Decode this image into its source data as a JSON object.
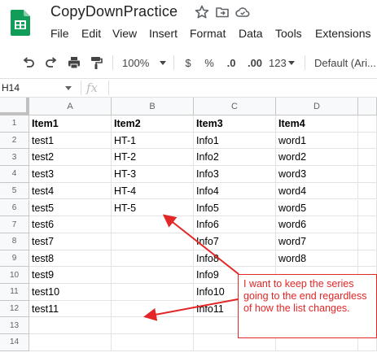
{
  "app": {
    "title": "CopyDownPractice",
    "menu": [
      "File",
      "Edit",
      "View",
      "Insert",
      "Format",
      "Data",
      "Tools",
      "Extensions"
    ]
  },
  "toolbar": {
    "zoom": "100%",
    "currency": "$",
    "percent": "%",
    "dec_decrease": ".0",
    "dec_increase": ".00",
    "more_formats": "123",
    "font": "Default (Ari..."
  },
  "formula_bar": {
    "name_box": "H14",
    "fx": "fx",
    "value": ""
  },
  "sheet": {
    "columns": [
      "A",
      "B",
      "C",
      "D"
    ],
    "rows": [
      {
        "num": "1",
        "cells": [
          "Item1",
          "Item2",
          "Item3",
          "Item4"
        ]
      },
      {
        "num": "2",
        "cells": [
          "test1",
          "HT-1",
          "Info1",
          "word1"
        ]
      },
      {
        "num": "3",
        "cells": [
          "test2",
          "HT-2",
          "Info2",
          "word2"
        ]
      },
      {
        "num": "4",
        "cells": [
          "test3",
          "HT-3",
          "Info3",
          "word3"
        ]
      },
      {
        "num": "5",
        "cells": [
          "test4",
          "HT-4",
          "Info4",
          "word4"
        ]
      },
      {
        "num": "6",
        "cells": [
          "test5",
          "HT-5",
          "Info5",
          "word5"
        ]
      },
      {
        "num": "7",
        "cells": [
          "test6",
          "",
          "Info6",
          "word6"
        ]
      },
      {
        "num": "8",
        "cells": [
          "test7",
          "",
          "Info7",
          "word7"
        ]
      },
      {
        "num": "9",
        "cells": [
          "test8",
          "",
          "Info8",
          "word8"
        ]
      },
      {
        "num": "10",
        "cells": [
          "test9",
          "",
          "Info9",
          ""
        ]
      },
      {
        "num": "11",
        "cells": [
          "test10",
          "",
          "Info10",
          ""
        ]
      },
      {
        "num": "12",
        "cells": [
          "test11",
          "",
          "Info11",
          ""
        ]
      },
      {
        "num": "13",
        "cells": [
          "",
          "",
          "",
          ""
        ]
      },
      {
        "num": "14",
        "cells": [
          "",
          "",
          "",
          ""
        ]
      }
    ]
  },
  "annotation": {
    "text": "I want to keep the series going to the end regardless of how the list changes.",
    "color": "#e32626"
  },
  "colors": {
    "sheets_green": "#0f9d58",
    "header_bg": "#f8f9fa",
    "gridline": "#e2e3e3"
  },
  "icons": [
    "sheets-logo-icon",
    "star-icon",
    "move-folder-icon",
    "cloud-status-icon",
    "undo-icon",
    "redo-icon",
    "print-icon",
    "paint-format-icon"
  ]
}
